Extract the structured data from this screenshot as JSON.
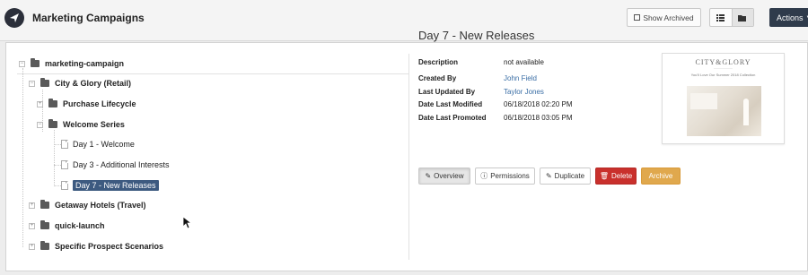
{
  "header": {
    "title": "Marketing Campaigns",
    "show_archived_label": "Show Archived",
    "actions_label": "Actions"
  },
  "tree": {
    "root": "marketing-campaign",
    "city_glory": "City & Glory (Retail)",
    "purchase_lifecycle": "Purchase Lifecycle",
    "welcome_series": "Welcome Series",
    "day1": "Day 1 - Welcome",
    "day3": "Day 3 - Additional Interests",
    "day7": "Day 7 - New Releases",
    "getaway": "Getaway Hotels (Travel)",
    "quick_launch": "quick-launch",
    "prospect": "Specific Prospect Scenarios"
  },
  "detail": {
    "title": "Day 7 - New Releases",
    "fields": [
      {
        "label": "Description",
        "value": "not available"
      },
      {
        "label": "Created By",
        "value": "John Field"
      },
      {
        "label": "Last Updated By",
        "value": "Taylor Jones"
      },
      {
        "label": "Date Last Modified",
        "value": "06/18/2018 02:20 PM"
      },
      {
        "label": "Date Last Promoted",
        "value": "06/18/2018 03:05 PM"
      }
    ],
    "thumbnail": {
      "brand": "CITY&GLORY",
      "headline": "You'll Love Our Summer 2018 Collection"
    }
  },
  "buttons": {
    "overview": "Overview",
    "permissions": "Permissions",
    "duplicate": "Duplicate",
    "delete": "Delete",
    "archive": "Archive"
  },
  "colors": {
    "selected": "#3d5a80",
    "delete": "#c9302c",
    "archive": "#e0a84d",
    "link": "#3a6ea5",
    "actions": "#2f3b4b"
  }
}
